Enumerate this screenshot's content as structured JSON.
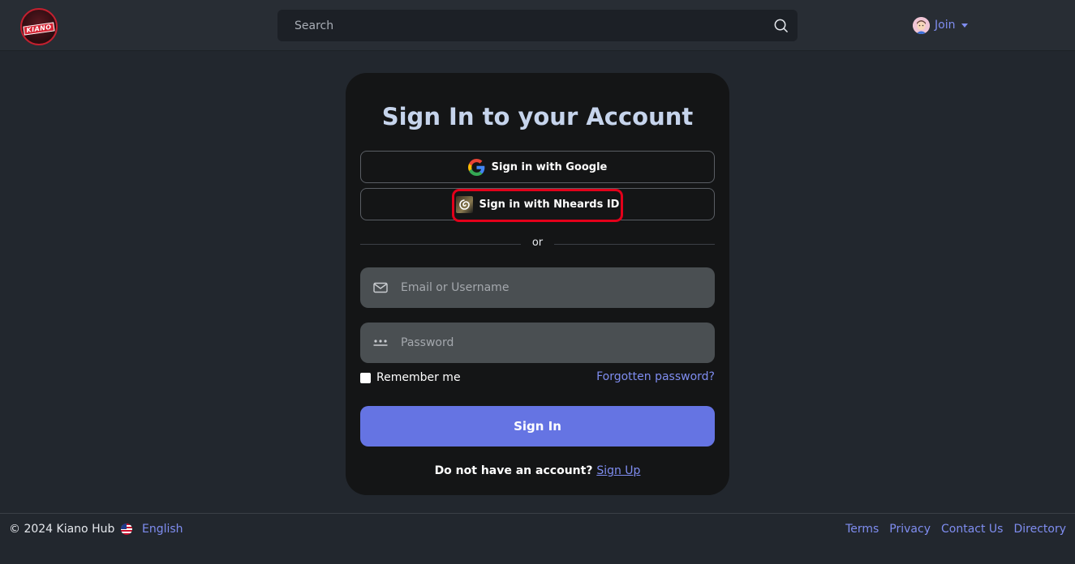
{
  "header": {
    "logo_text": "KIANO",
    "search_placeholder": "Search",
    "join_label": "Join"
  },
  "card": {
    "title": "Sign In to your Account",
    "google_label": "Sign in with Google",
    "nheards_label": "Sign in with Nheards ID",
    "or_text": "or",
    "email_placeholder": "Email or Username",
    "password_placeholder": "Password",
    "remember_label": "Remember me",
    "forgot_label": "Forgotten password?",
    "signin_label": "Sign In",
    "no_account_text": "Do not have an account?",
    "signup_label": "Sign Up"
  },
  "footer": {
    "copyright": "© 2024 Kiano Hub",
    "language": "English",
    "links": [
      "Terms",
      "Privacy",
      "Contact Us",
      "Directory"
    ]
  },
  "colors": {
    "accent": "#6574e3",
    "link": "#7f8df0",
    "highlight": "#e3001a"
  },
  "icons": [
    "logo-icon",
    "search-icon",
    "avatar-icon",
    "chevron-down-icon",
    "google-icon",
    "nheards-icon",
    "mail-icon",
    "password-dots-icon",
    "us-flag-icon"
  ]
}
